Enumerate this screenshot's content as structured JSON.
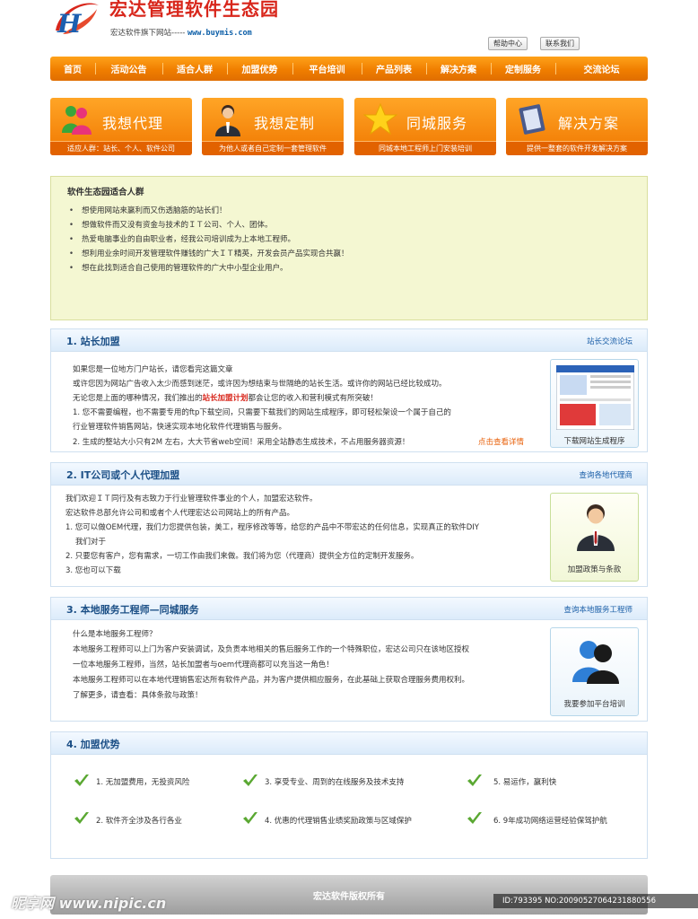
{
  "header": {
    "title": "宏达管理软件生态园",
    "subtitle_prefix": "宏达软件旗下网站-----",
    "subtitle_url": "www.buymis.com",
    "help_label": "帮助中心",
    "contact_label": "联系我们"
  },
  "nav": [
    "首页",
    "活动公告",
    "适合人群",
    "加盟优势",
    "平台培训",
    "产品列表",
    "解决方案",
    "定制服务",
    "交流论坛"
  ],
  "features": [
    {
      "title": "我想代理",
      "sub": "适应人群：站长、个人、软件公司",
      "icon": "people-icon"
    },
    {
      "title": "我想定制",
      "sub": "为他人或者自己定制一套管理软件",
      "icon": "businessman-icon"
    },
    {
      "title": "同城服务",
      "sub": "同城本地工程师上门安装培训",
      "icon": "star-icon"
    },
    {
      "title": "解决方案",
      "sub": "提供一整套的软件开发解决方案",
      "icon": "notebook-icon"
    }
  ],
  "audience": {
    "title": "软件生态园适合人群",
    "items": [
      "想使用网站来赢利而又伤透脑筋的站长们！",
      "想做软件而又没有资金与技术的ＩＴ公司、个人、团体。",
      "热爱电脑事业的自由职业者，经我公司培训成为上本地工程师。",
      "想利用业余时间开发管理软件赚钱的广大ＩＴ精英，开发会员产品实现合共赢！",
      "想在此找到适合自己使用的管理软件的广大中小型企业用户。"
    ]
  },
  "section1": {
    "title": "1. 站长加盟",
    "link": "站长交流论坛",
    "lines": [
      "如果您是一位地方门户站长，请您看完这篇文章",
      "或许您因为网站广告收入太少而感到迷茫，或许因为想结束与世隔绝的站长生活。或许你的网站已经比较成功。",
      "1. 您不需要编程，也不需要专用的ftp下载空间，只需要下载我们的网站生成程序，即可轻松架设一个属于自己的",
      "行业管理软件销售网站，快速实现本地化软件代理销售与服务。",
      "2. 生成的整站大小只有2M 左右，大大节省web空间！采用全站静态生成技术，不占用服务器资源！"
    ],
    "line3_prefix": "无论您是上面的哪种情况，我们推出的",
    "line3_highlight": "站长加盟计划",
    "line3_suffix": "都会让您的收入和营利模式有所突破！",
    "more": "点击查看详情",
    "card_caption": "下载网站生成程序"
  },
  "section2": {
    "title": "2. IT公司或个人代理加盟",
    "link": "查询各地代理商",
    "lines": [
      "我们欢迎ＩＴ同行及有志致力于行业管理软件事业的个人，加盟宏达软件。",
      "宏达软件总部允许公司和或者个人代理宏达公司网站上的所有产品。",
      "1. 您可以做OEM代理，我们力您提供包装，美工，程序修改等等，给您的产品中不带宏达的任何信息，实现真正的软件DIY",
      "我们对于",
      "2. 只要您有客户，您有需求，一切工作由我们来做。我们将为您（代理商）提供全方位的定制开发服务。",
      "3. 您也可以下载"
    ],
    "card_caption": "加盟政策与条款"
  },
  "section3": {
    "title": "3. 本地服务工程师—同城服务",
    "link": "查询本地服务工程师",
    "lines": [
      "什么是本地服务工程师？",
      "本地服务工程师可以上门为客户安装调试，及负责本地相关的售后服务工作的一个特殊职位，宏达公司只在该地区授权",
      "一位本地服务工程师，当然，站长加盟者与oem代理商都可以充当这一角色！",
      "本地服务工程师可以在本地代理销售宏达所有软件产品，并为客户提供相应服务，在此基础上获取合理服务费用权利。",
      "了解更多，请查看：具体条款与政策！"
    ],
    "card_caption": "我要参加平台培训"
  },
  "section4": {
    "title": "4. 加盟优势",
    "items": [
      "1. 无加盟费用，无投资风险",
      "3. 享受专业、周到的在线服务及技术支持",
      "5. 易运作，赢利快",
      "2. 软件齐全涉及各行各业",
      "4. 优惠的代理销售业绩奖励政策与区域保护",
      "6. 9年成功网络运营经验保驾护航"
    ]
  },
  "footer": {
    "copyright": "宏达软件版权所有"
  },
  "watermark": {
    "left": "昵享网 www.nipic.cn",
    "right": "ID:793395 NO:20090527064231880556"
  },
  "colors": {
    "nav_orange": "#f07e00",
    "section_title_blue": "#1b4f86",
    "highlight_red": "#d8261b",
    "audience_bg": "#f4f7d2"
  }
}
